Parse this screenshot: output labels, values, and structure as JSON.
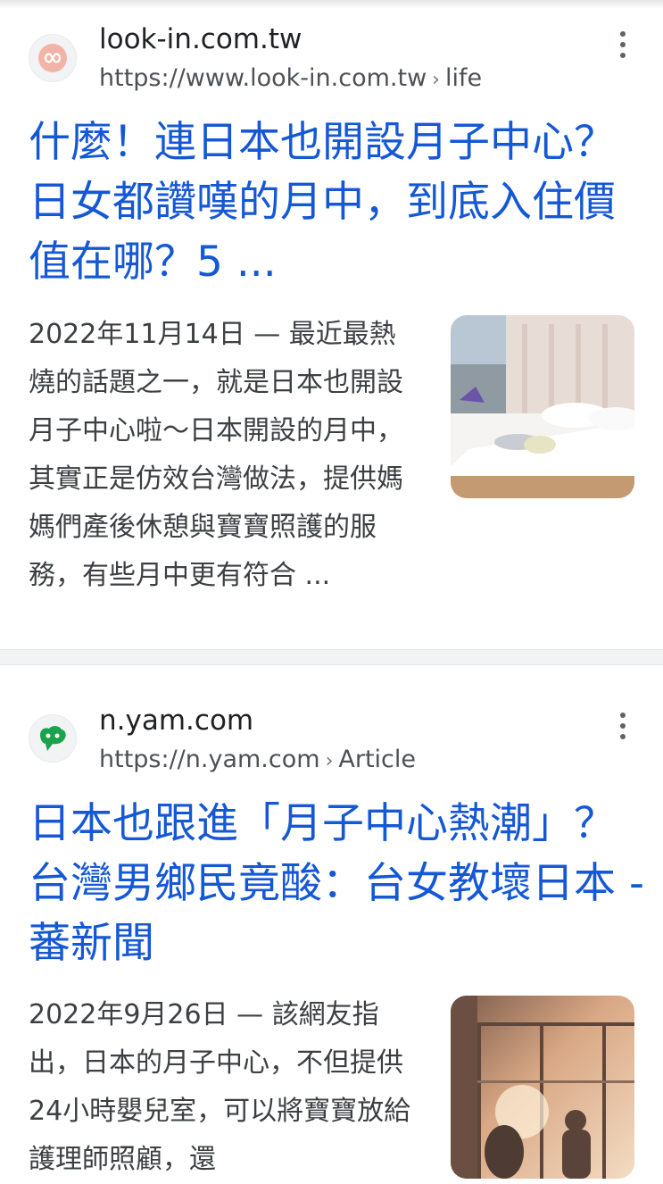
{
  "results": [
    {
      "site_name": "look-in.com.tw",
      "url": "https://www.look-in.com.tw",
      "url_path": "life",
      "title": "什麼！連日本也開設月子中心？日女都讚嘆的月中，到底入住價值在哪？5 ...",
      "snippet_date": "2022年11月14日",
      "snippet_text": "最近最熱燒的話題之一，就是日本也開設月子中心啦～日本開設的月中，其實正是仿效台灣做法，提供媽媽們產後休憩與寶寶照護的服務，有些月中更有符合 ...",
      "favicon": "infinity-icon",
      "thumbnail": "hotel-bedroom-image"
    },
    {
      "site_name": "n.yam.com",
      "url": "https://n.yam.com",
      "url_path": "Article",
      "title": "日本也跟進「月子中心熱潮」？台灣男鄉民竟酸：台女教壞日本 - 蕃新聞",
      "snippet_date": "2022年9月26日",
      "snippet_text": "該網友指出，日本的月子中心，不但提供24小時嬰兒室，可以將寶寶放給護理師照顧，還",
      "favicon": "yam-logo-icon",
      "thumbnail": "sunset-window-image"
    }
  ],
  "colors": {
    "title": "#1558d6",
    "snippet": "#3c4043",
    "url": "#4d5156"
  }
}
